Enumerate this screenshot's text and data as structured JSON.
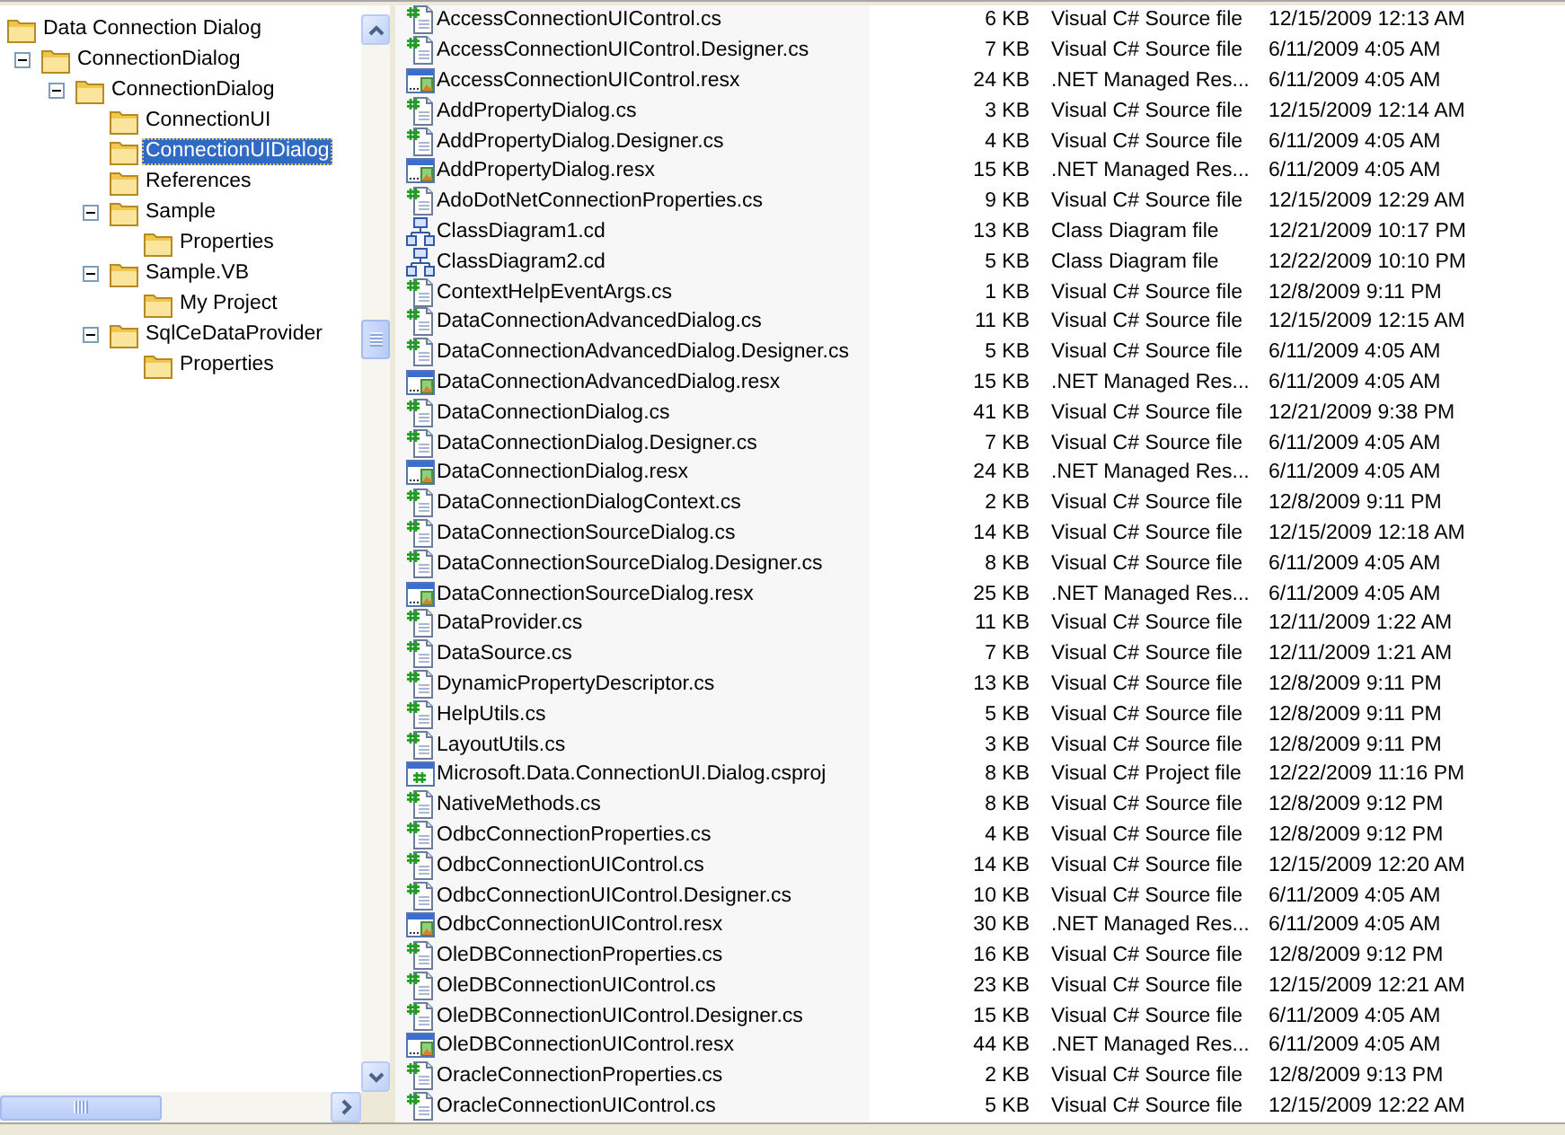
{
  "tree": {
    "items": [
      {
        "label": "Data Connection Dialog",
        "selected": false,
        "children": [
          {
            "label": "ConnectionDialog",
            "selected": false,
            "expanded": true,
            "children": [
              {
                "label": "ConnectionDialog",
                "selected": false,
                "expanded": true,
                "children": [
                  {
                    "label": "ConnectionUI",
                    "selected": false
                  },
                  {
                    "label": "ConnectionUIDialog",
                    "selected": true
                  },
                  {
                    "label": "References",
                    "selected": false
                  },
                  {
                    "label": "Sample",
                    "selected": false,
                    "expanded": true,
                    "children": [
                      {
                        "label": "Properties",
                        "selected": false
                      }
                    ]
                  },
                  {
                    "label": "Sample.VB",
                    "selected": false,
                    "expanded": true,
                    "children": [
                      {
                        "label": "My Project",
                        "selected": false
                      }
                    ]
                  },
                  {
                    "label": "SqlCeDataProvider",
                    "selected": false,
                    "expanded": true,
                    "children": [
                      {
                        "label": "Properties",
                        "selected": false
                      }
                    ]
                  }
                ]
              }
            ]
          }
        ]
      }
    ]
  },
  "file_list": {
    "rows": [
      {
        "kind": "cs",
        "cells": [
          "AccessConnectionUIControl.cs",
          "6 KB",
          "Visual C# Source file",
          "12/15/2009 12:13 AM"
        ]
      },
      {
        "kind": "cs",
        "cells": [
          "AccessConnectionUIControl.Designer.cs",
          "7 KB",
          "Visual C# Source file",
          "6/11/2009 4:05 AM"
        ]
      },
      {
        "kind": "resx",
        "cells": [
          "AccessConnectionUIControl.resx",
          "24 KB",
          ".NET Managed Res...",
          "6/11/2009 4:05 AM"
        ]
      },
      {
        "kind": "cs",
        "cells": [
          "AddPropertyDialog.cs",
          "3 KB",
          "Visual C# Source file",
          "12/15/2009 12:14 AM"
        ]
      },
      {
        "kind": "cs",
        "cells": [
          "AddPropertyDialog.Designer.cs",
          "4 KB",
          "Visual C# Source file",
          "6/11/2009 4:05 AM"
        ]
      },
      {
        "kind": "resx",
        "cells": [
          "AddPropertyDialog.resx",
          "15 KB",
          ".NET Managed Res...",
          "6/11/2009 4:05 AM"
        ]
      },
      {
        "kind": "cs",
        "cells": [
          "AdoDotNetConnectionProperties.cs",
          "9 KB",
          "Visual C# Source file",
          "12/15/2009 12:29 AM"
        ]
      },
      {
        "kind": "cd",
        "cells": [
          "ClassDiagram1.cd",
          "13 KB",
          "Class Diagram file",
          "12/21/2009 10:17 PM"
        ]
      },
      {
        "kind": "cd",
        "cells": [
          "ClassDiagram2.cd",
          "5 KB",
          "Class Diagram file",
          "12/22/2009 10:10 PM"
        ]
      },
      {
        "kind": "cs",
        "cells": [
          "ContextHelpEventArgs.cs",
          "1 KB",
          "Visual C# Source file",
          "12/8/2009 9:11 PM"
        ]
      },
      {
        "kind": "cs",
        "cells": [
          "DataConnectionAdvancedDialog.cs",
          "11 KB",
          "Visual C# Source file",
          "12/15/2009 12:15 AM"
        ]
      },
      {
        "kind": "cs",
        "cells": [
          "DataConnectionAdvancedDialog.Designer.cs",
          "5 KB",
          "Visual C# Source file",
          "6/11/2009 4:05 AM"
        ]
      },
      {
        "kind": "resx",
        "cells": [
          "DataConnectionAdvancedDialog.resx",
          "15 KB",
          ".NET Managed Res...",
          "6/11/2009 4:05 AM"
        ]
      },
      {
        "kind": "cs",
        "cells": [
          "DataConnectionDialog.cs",
          "41 KB",
          "Visual C# Source file",
          "12/21/2009 9:38 PM"
        ]
      },
      {
        "kind": "cs",
        "cells": [
          "DataConnectionDialog.Designer.cs",
          "7 KB",
          "Visual C# Source file",
          "6/11/2009 4:05 AM"
        ]
      },
      {
        "kind": "resx",
        "cells": [
          "DataConnectionDialog.resx",
          "24 KB",
          ".NET Managed Res...",
          "6/11/2009 4:05 AM"
        ]
      },
      {
        "kind": "cs",
        "cells": [
          "DataConnectionDialogContext.cs",
          "2 KB",
          "Visual C# Source file",
          "12/8/2009 9:11 PM"
        ]
      },
      {
        "kind": "cs",
        "cells": [
          "DataConnectionSourceDialog.cs",
          "14 KB",
          "Visual C# Source file",
          "12/15/2009 12:18 AM"
        ]
      },
      {
        "kind": "cs",
        "cells": [
          "DataConnectionSourceDialog.Designer.cs",
          "8 KB",
          "Visual C# Source file",
          "6/11/2009 4:05 AM"
        ]
      },
      {
        "kind": "resx",
        "cells": [
          "DataConnectionSourceDialog.resx",
          "25 KB",
          ".NET Managed Res...",
          "6/11/2009 4:05 AM"
        ]
      },
      {
        "kind": "cs",
        "cells": [
          "DataProvider.cs",
          "11 KB",
          "Visual C# Source file",
          "12/11/2009 1:22 AM"
        ]
      },
      {
        "kind": "cs",
        "cells": [
          "DataSource.cs",
          "7 KB",
          "Visual C# Source file",
          "12/11/2009 1:21 AM"
        ]
      },
      {
        "kind": "cs",
        "cells": [
          "DynamicPropertyDescriptor.cs",
          "13 KB",
          "Visual C# Source file",
          "12/8/2009 9:11 PM"
        ]
      },
      {
        "kind": "cs",
        "cells": [
          "HelpUtils.cs",
          "5 KB",
          "Visual C# Source file",
          "12/8/2009 9:11 PM"
        ]
      },
      {
        "kind": "cs",
        "cells": [
          "LayoutUtils.cs",
          "3 KB",
          "Visual C# Source file",
          "12/8/2009 9:11 PM"
        ]
      },
      {
        "kind": "csproj",
        "cells": [
          "Microsoft.Data.ConnectionUI.Dialog.csproj",
          "8 KB",
          "Visual C# Project file",
          "12/22/2009 11:16 PM"
        ]
      },
      {
        "kind": "cs",
        "cells": [
          "NativeMethods.cs",
          "8 KB",
          "Visual C# Source file",
          "12/8/2009 9:12 PM"
        ]
      },
      {
        "kind": "cs",
        "cells": [
          "OdbcConnectionProperties.cs",
          "4 KB",
          "Visual C# Source file",
          "12/8/2009 9:12 PM"
        ]
      },
      {
        "kind": "cs",
        "cells": [
          "OdbcConnectionUIControl.cs",
          "14 KB",
          "Visual C# Source file",
          "12/15/2009 12:20 AM"
        ]
      },
      {
        "kind": "cs",
        "cells": [
          "OdbcConnectionUIControl.Designer.cs",
          "10 KB",
          "Visual C# Source file",
          "6/11/2009 4:05 AM"
        ]
      },
      {
        "kind": "resx",
        "cells": [
          "OdbcConnectionUIControl.resx",
          "30 KB",
          ".NET Managed Res...",
          "6/11/2009 4:05 AM"
        ]
      },
      {
        "kind": "cs",
        "cells": [
          "OleDBConnectionProperties.cs",
          "16 KB",
          "Visual C# Source file",
          "12/8/2009 9:12 PM"
        ]
      },
      {
        "kind": "cs",
        "cells": [
          "OleDBConnectionUIControl.cs",
          "23 KB",
          "Visual C# Source file",
          "12/15/2009 12:21 AM"
        ]
      },
      {
        "kind": "cs",
        "cells": [
          "OleDBConnectionUIControl.Designer.cs",
          "15 KB",
          "Visual C# Source file",
          "6/11/2009 4:05 AM"
        ]
      },
      {
        "kind": "resx",
        "cells": [
          "OleDBConnectionUIControl.resx",
          "44 KB",
          ".NET Managed Res...",
          "6/11/2009 4:05 AM"
        ]
      },
      {
        "kind": "cs",
        "cells": [
          "OracleConnectionProperties.cs",
          "2 KB",
          "Visual C# Source file",
          "12/8/2009 9:13 PM"
        ]
      },
      {
        "kind": "cs",
        "cells": [
          "OracleConnectionUIControl.cs",
          "5 KB",
          "Visual C# Source file",
          "12/15/2009 12:22 AM"
        ]
      }
    ]
  }
}
